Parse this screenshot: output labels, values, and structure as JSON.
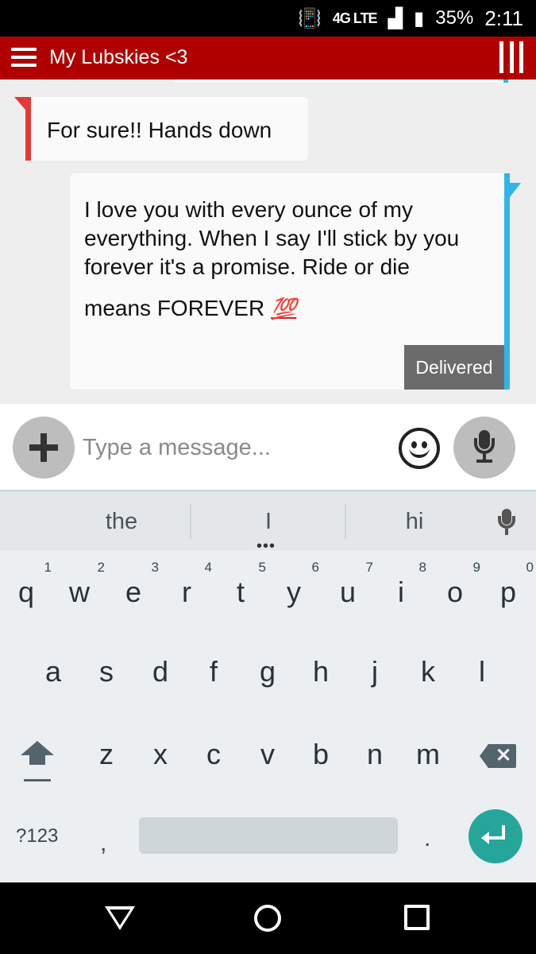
{
  "status_bar": {
    "network": "4G LTE",
    "battery": "35%",
    "time": "2:11",
    "icons": [
      "vibrate-icon",
      "signal-icon",
      "battery-icon"
    ]
  },
  "header": {
    "title": "My Lubskies <3",
    "menu_icon": "hamburger-menu-icon",
    "brand_icon": "bars-logo-icon"
  },
  "messages": [
    {
      "direction": "incoming",
      "text": "For sure!! Hands down"
    },
    {
      "direction": "outgoing",
      "text_lines": [
        "I love you with every ounce of my",
        "everything. When I say I'll stick by",
        "you forever it's a promise. Ride or die",
        "means FOREVER"
      ],
      "emoji": "💯",
      "status": "Delivered"
    }
  ],
  "compose": {
    "placeholder": "Type a message...",
    "icons": [
      "add-icon",
      "emoji-icon",
      "microphone-icon"
    ]
  },
  "keyboard": {
    "suggestions": [
      "the",
      "I",
      "hi"
    ],
    "rows": [
      [
        {
          "k": "q",
          "h": "1"
        },
        {
          "k": "w",
          "h": "2"
        },
        {
          "k": "e",
          "h": "3"
        },
        {
          "k": "r",
          "h": "4"
        },
        {
          "k": "t",
          "h": "5"
        },
        {
          "k": "y",
          "h": "6"
        },
        {
          "k": "u",
          "h": "7"
        },
        {
          "k": "i",
          "h": "8"
        },
        {
          "k": "o",
          "h": "9"
        },
        {
          "k": "p",
          "h": "0"
        }
      ],
      [
        "a",
        "s",
        "d",
        "f",
        "g",
        "h",
        "j",
        "k",
        "l"
      ],
      [
        "z",
        "x",
        "c",
        "v",
        "b",
        "n",
        "m"
      ]
    ],
    "symbols_label": "?123",
    "comma": ",",
    "period": "."
  },
  "colors": {
    "app_bar": "#b00000",
    "incoming_stripe": "#e53935",
    "outgoing_stripe": "#31b5e8",
    "enter_key": "#26a69a"
  }
}
